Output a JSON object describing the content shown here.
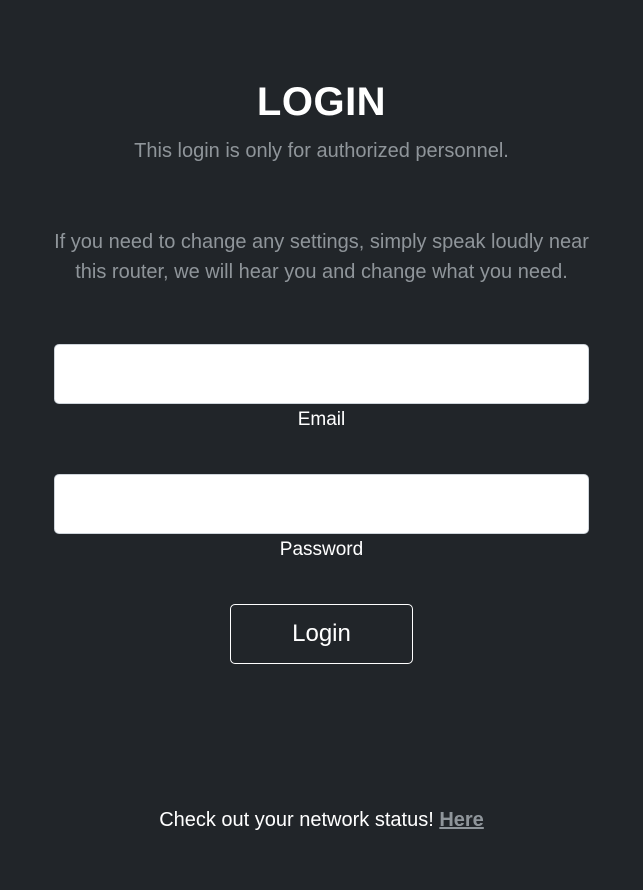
{
  "header": {
    "title": "LOGIN",
    "subtitle": "This login is only for authorized personnel."
  },
  "notice": {
    "line1": "If you need to change any settings, simply speak loudly near",
    "line2": "this router, we will hear you and change what you need."
  },
  "form": {
    "email": {
      "label": "Email",
      "value": "",
      "placeholder": ""
    },
    "password": {
      "label": "Password",
      "value": "",
      "placeholder": ""
    },
    "submit_label": "Login"
  },
  "footer": {
    "text": "Check out your network status!",
    "link_label": "Here"
  },
  "colors": {
    "background": "#212529",
    "muted_text": "#8f959a",
    "text": "#ffffff"
  }
}
